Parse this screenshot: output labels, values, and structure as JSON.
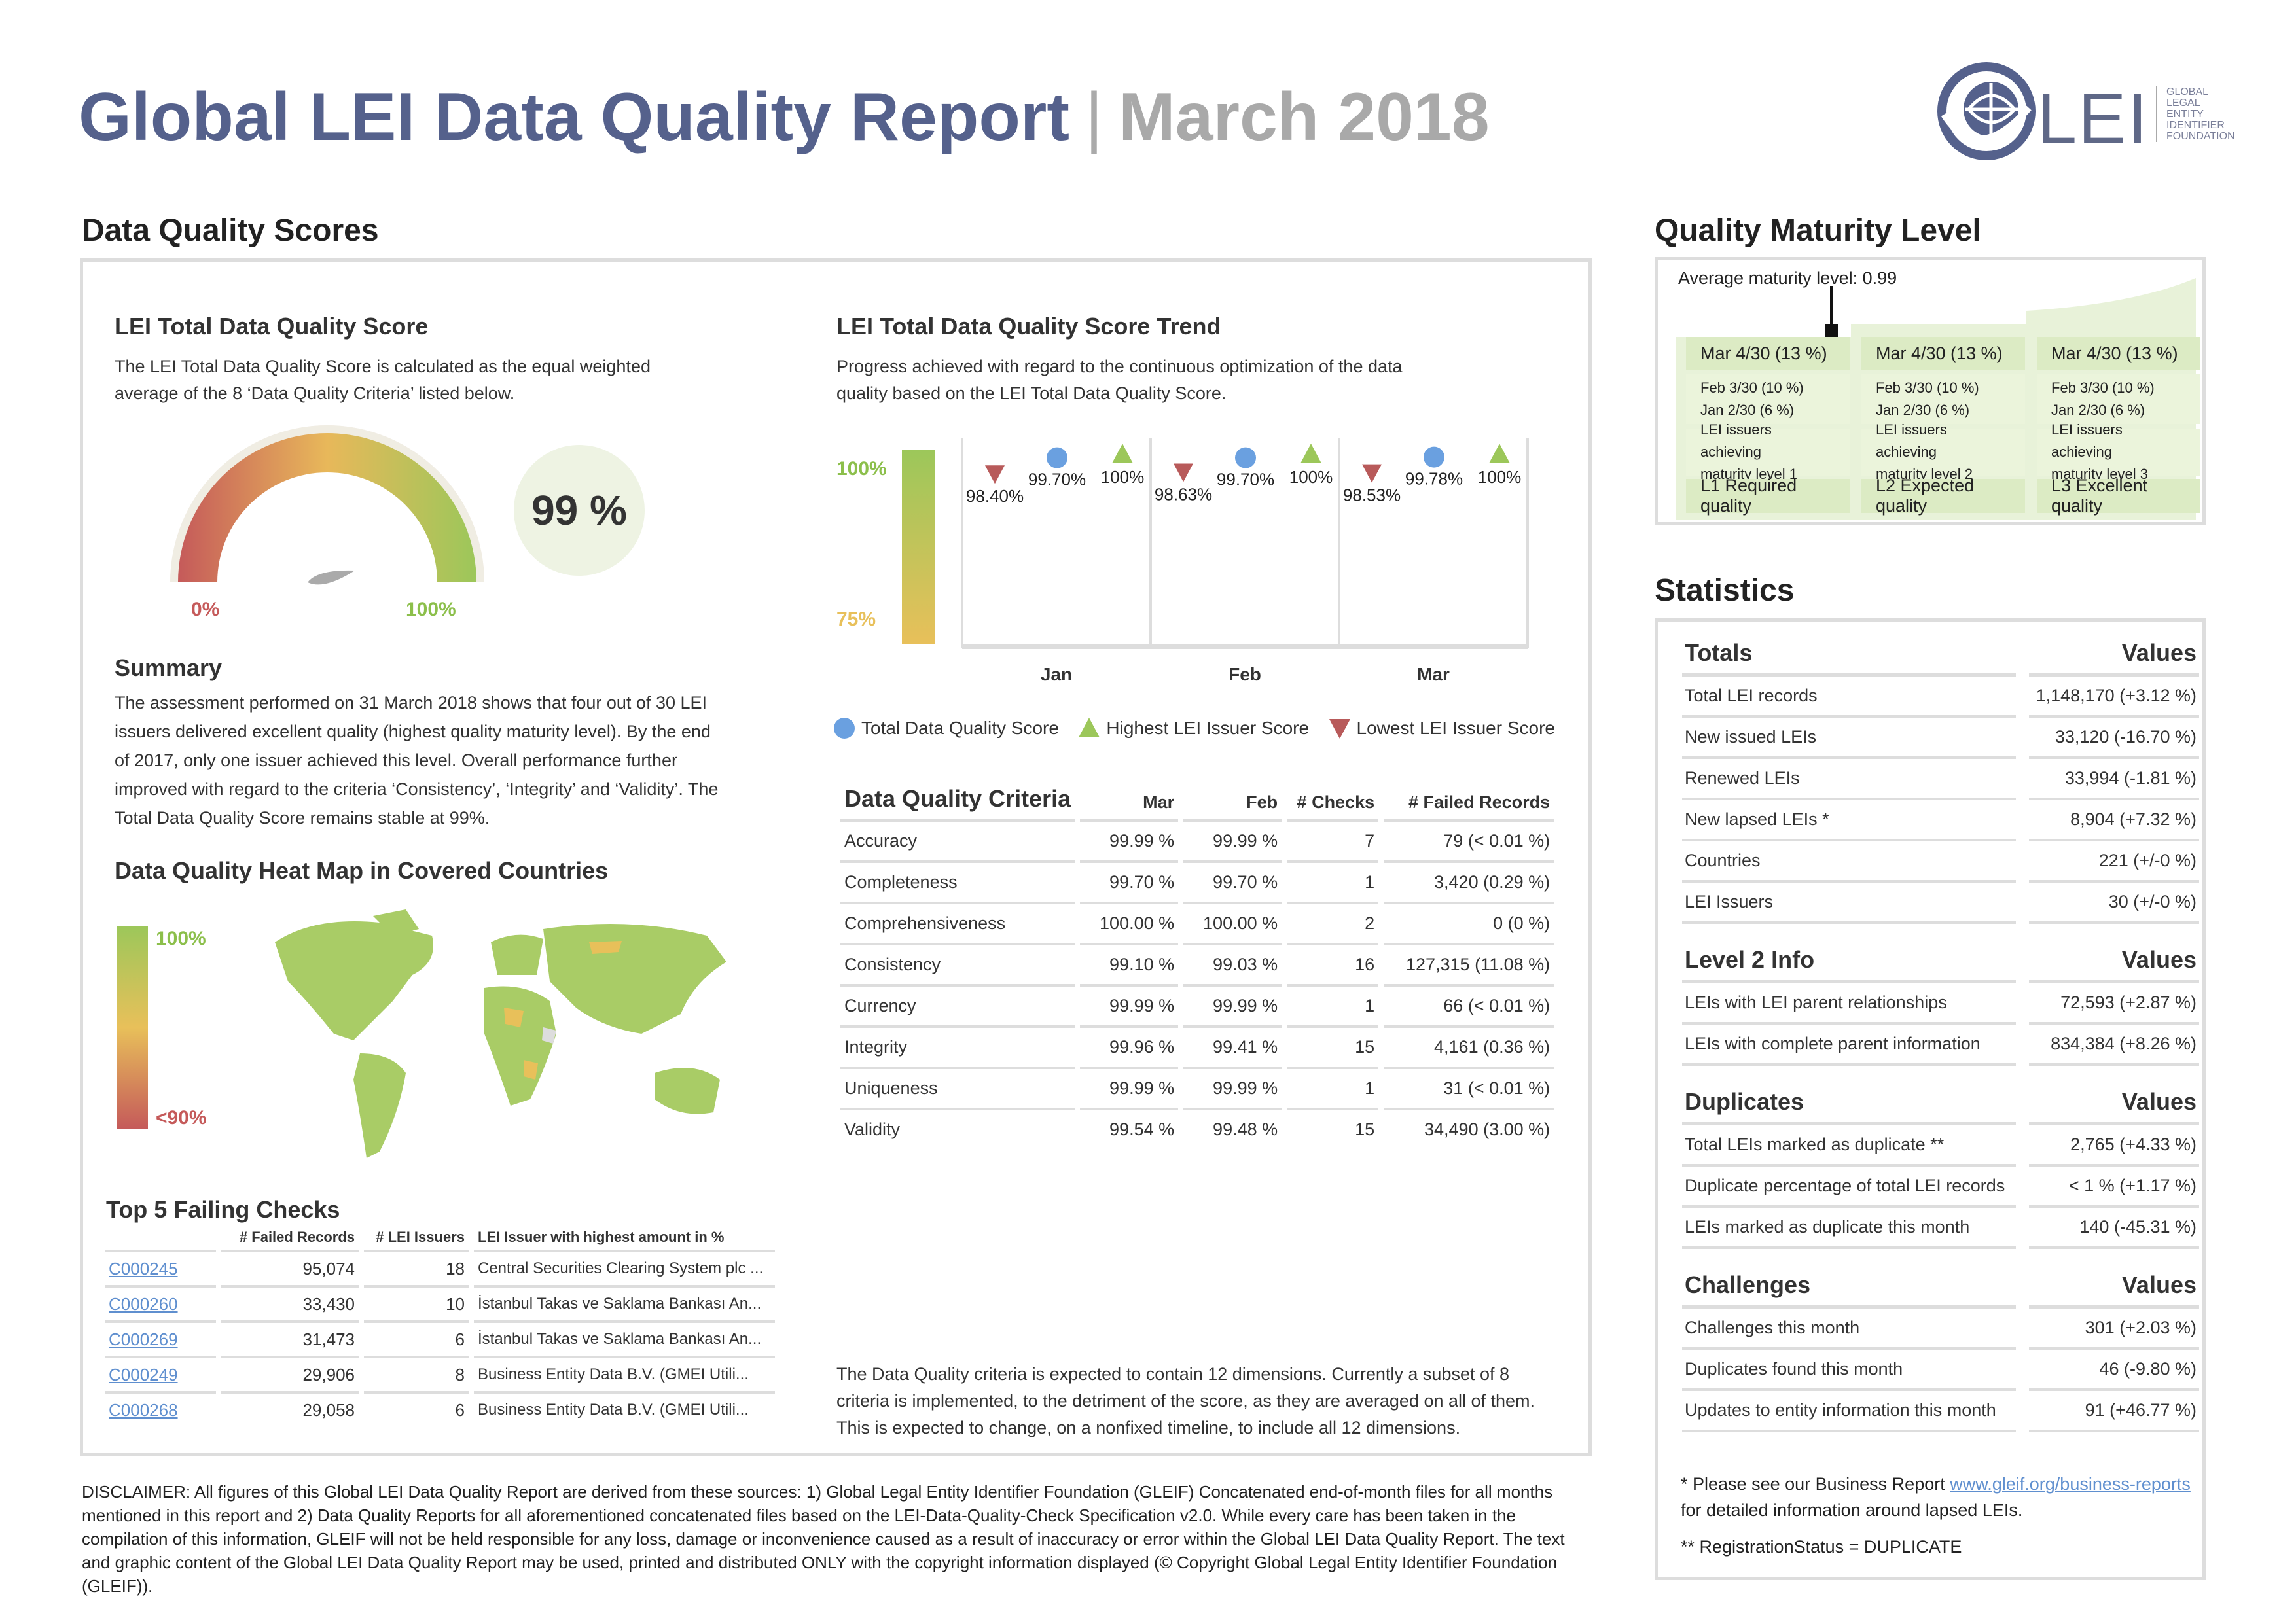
{
  "header": {
    "title": "Global LEI Data Quality Report",
    "separator": "|",
    "date": "March 2018",
    "logo_text": "LEI",
    "logo_side": [
      "GLOBAL",
      "LEGAL",
      "ENTITY",
      "IDENTIFIER",
      "FOUNDATION"
    ]
  },
  "scores": {
    "section_title": "Data Quality Scores",
    "total_title": "LEI Total Data Quality Score",
    "total_desc": "The LEI Total Data Quality Score is calculated as the equal weighted average of the 8 ‘Data Quality Criteria’ listed below.",
    "gauge_value": "99 %",
    "gauge_fraction": 0.99,
    "gauge_min": "0%",
    "gauge_max": "100%",
    "summary_title": "Summary",
    "summary_text": "The assessment performed on 31 March 2018 shows that four out of 30 LEI issuers delivered excellent quality (highest quality maturity level). By the end of 2017, only one issuer achieved this level. Overall performance further improved with regard to the criteria ‘Consistency’, ‘Integrity’ and ‘Validity’. The Total Data Quality Score remains stable at 99%.",
    "heatmap_title": "Data Quality Heat Map in Covered Countries",
    "heatmap_max": "100%",
    "heatmap_min": "<90%"
  },
  "trend": {
    "title": "LEI Total Data Quality Score Trend",
    "desc": "Progress achieved with regard to the continuous optimization of the data quality based on the LEI Total Data Quality Score.",
    "scale_top": "100%",
    "scale_bottom": "75%",
    "legend": {
      "total": "Total Data Quality Score",
      "highest": "Highest LEI Issuer Score",
      "lowest": "Lowest LEI Issuer Score"
    }
  },
  "chart_data": {
    "type": "scatter",
    "categories": [
      "Jan",
      "Feb",
      "Mar"
    ],
    "series": [
      {
        "name": "Lowest LEI Issuer Score",
        "values": [
          98.4,
          98.63,
          98.53
        ],
        "labels": [
          "98.40%",
          "98.63%",
          "98.53%"
        ],
        "color": "#b85a5a",
        "marker": "triangle-down"
      },
      {
        "name": "Total Data Quality Score",
        "values": [
          99.7,
          99.7,
          99.78
        ],
        "labels": [
          "99.70%",
          "99.70%",
          "99.78%"
        ],
        "color": "#6aa0e0",
        "marker": "circle"
      },
      {
        "name": "Highest LEI Issuer Score",
        "values": [
          100,
          100,
          100
        ],
        "labels": [
          "100%",
          "100%",
          "100%"
        ],
        "color": "#9cc75a",
        "marker": "triangle-up"
      }
    ]
  },
  "criteria": {
    "title": "Data Quality Criteria",
    "headers": [
      "Mar",
      "Feb",
      "# Checks",
      "# Failed Records"
    ],
    "rows": [
      [
        "Accuracy",
        "99.99 %",
        "99.99 %",
        "7",
        "79 (< 0.01 %)"
      ],
      [
        "Completeness",
        "99.70 %",
        "99.70 %",
        "1",
        "3,420 (0.29 %)"
      ],
      [
        "Comprehensiveness",
        "100.00 %",
        "100.00 %",
        "2",
        "0 (0 %)"
      ],
      [
        "Consistency",
        "99.10 %",
        "99.03 %",
        "16",
        "127,315 (11.08 %)"
      ],
      [
        "Currency",
        "99.99 %",
        "99.99 %",
        "1",
        "66 (< 0.01 %)"
      ],
      [
        "Integrity",
        "99.96 %",
        "99.41 %",
        "15",
        "4,161 (0.36 %)"
      ],
      [
        "Uniqueness",
        "99.99 %",
        "99.99 %",
        "1",
        "31 (< 0.01 %)"
      ],
      [
        "Validity",
        "99.54 %",
        "99.48 %",
        "15",
        "34,490 (3.00 %)"
      ]
    ],
    "note": "The Data Quality criteria is expected to contain 12 dimensions. Currently a subset of 8 criteria is implemented, to the detriment of the score, as they are averaged on all of them. This is expected to change, on a nonfixed timeline, to include all 12 dimensions."
  },
  "failing": {
    "title": "Top 5 Failing Checks",
    "headers": [
      "# Failed Records",
      "# LEI Issuers",
      "LEI Issuer with highest amount in %"
    ],
    "rows": [
      [
        "C000245",
        "95,074",
        "18",
        "Central Securities Clearing System plc ..."
      ],
      [
        "C000260",
        "33,430",
        "10",
        "İstanbul Takas ve Saklama Bankası An..."
      ],
      [
        "C000269",
        "31,473",
        "6",
        "İstanbul Takas ve Saklama Bankası An..."
      ],
      [
        "C000249",
        "29,906",
        "8",
        "Business Entity Data B.V. (GMEI Utili..."
      ],
      [
        "C000268",
        "29,058",
        "6",
        "Business Entity Data B.V. (GMEI Utili..."
      ]
    ]
  },
  "maturity": {
    "title": "Quality Maturity Level",
    "average": "Average maturity level: 0.99",
    "average_value": 0.99,
    "columns": [
      {
        "top": "Mar 4/30 (13 %)",
        "feb": "Feb 3/30 (10 %)",
        "jan": "Jan 2/30 (6 %)",
        "desc1": "LEI issuers achieving",
        "desc2": "maturity level 1",
        "level": "L1 Required quality"
      },
      {
        "top": "Mar 4/30 (13 %)",
        "feb": "Feb 3/30 (10 %)",
        "jan": "Jan 2/30 (6 %)",
        "desc1": "LEI issuers achieving",
        "desc2": "maturity level 2",
        "level": "L2 Expected quality"
      },
      {
        "top": "Mar 4/30 (13 %)",
        "feb": "Feb 3/30 (10 %)",
        "jan": "Jan 2/30 (6 %)",
        "desc1": "LEI issuers achieving",
        "desc2": "maturity level 3",
        "level": "L3 Excellent quality"
      }
    ]
  },
  "statistics": {
    "title": "Statistics",
    "values_label": "Values",
    "groups": [
      {
        "title": "Totals",
        "rows": [
          [
            "Total LEI records",
            "1,148,170 (+3.12 %)"
          ],
          [
            "New issued LEIs",
            "33,120 (-16.70 %)"
          ],
          [
            "Renewed LEIs",
            "33,994 (-1.81 %)"
          ],
          [
            "New lapsed LEIs *",
            "8,904 (+7.32 %)"
          ],
          [
            "Countries",
            "221 (+/-0 %)"
          ],
          [
            "LEI Issuers",
            "30 (+/-0 %)"
          ]
        ]
      },
      {
        "title": "Level 2 Info",
        "rows": [
          [
            "LEIs with LEI parent relationships",
            "72,593 (+2.87 %)"
          ],
          [
            "LEIs with complete parent information",
            "834,384 (+8.26 %)"
          ]
        ]
      },
      {
        "title": "Duplicates",
        "rows": [
          [
            "Total LEIs marked as duplicate **",
            "2,765 (+4.33 %)"
          ],
          [
            "Duplicate percentage of total LEI records",
            "< 1 % (+1.17 %)"
          ],
          [
            "LEIs marked as duplicate this month",
            "140 (-45.31 %)"
          ]
        ]
      },
      {
        "title": "Challenges",
        "rows": [
          [
            "Challenges this month",
            "301 (+2.03 %)"
          ],
          [
            "Duplicates found this month",
            "46 (-9.80 %)"
          ],
          [
            "Updates to entity information this month",
            "91 (+46.77 %)"
          ]
        ]
      }
    ],
    "foot1": "* Please see our Business Report ",
    "foot1_link": "www.gleif.org/business-reports",
    "foot1b": "for detailed information around lapsed LEIs.",
    "foot2": "** RegistrationStatus = DUPLICATE"
  },
  "disclaimer": "DISCLAIMER: All figures of this Global LEI Data Quality Report are derived from these sources: 1) Global Legal Entity Identifier Foundation (GLEIF) Concatenated end-of-month files for all months mentioned in this report and 2) Data Quality Reports for all aforementioned concatenated files based on the LEI-Data-Quality-Check Specification v2.0. While every care has been taken in the compilation of this information, GLEIF will not be held responsible for any loss, damage or inconvenience caused as a result of inaccuracy or error within the Global LEI Data Quality Report. The text and graphic content of the Global LEI Data Quality Report may be used, printed and distributed ONLY with the copyright information displayed (© Copyright Global Legal Entity Identifier Foundation (GLEIF))."
}
